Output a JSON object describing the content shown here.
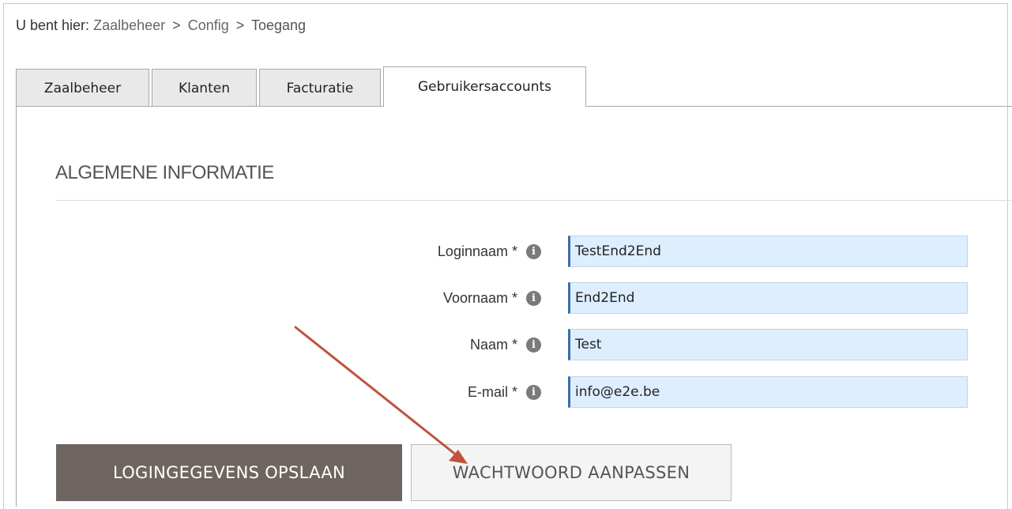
{
  "breadcrumb": {
    "prefix": "U bent hier:",
    "items": [
      "Zaalbeheer",
      "Config",
      "Toegang"
    ],
    "separator": ">"
  },
  "tabs": [
    {
      "label": "Zaalbeheer",
      "active": false
    },
    {
      "label": "Klanten",
      "active": false
    },
    {
      "label": "Facturatie",
      "active": false
    },
    {
      "label": "Gebruikersaccounts",
      "active": true
    }
  ],
  "section": {
    "title": "ALGEMENE INFORMATIE"
  },
  "form": {
    "fields": [
      {
        "label": "Loginnaam *",
        "value": "TestEnd2End",
        "info_icon": "info-icon"
      },
      {
        "label": "Voornaam *",
        "value": "End2End",
        "info_icon": "info-icon"
      },
      {
        "label": "Naam *",
        "value": "Test",
        "info_icon": "info-icon"
      },
      {
        "label": "E-mail *",
        "value": "info@e2e.be",
        "info_icon": "info-icon"
      }
    ],
    "info_glyph": "i"
  },
  "buttons": {
    "save_label": "LOGINGEGEVENS OPSLAAN",
    "password_label": "WACHTWOORD AANPASSEN"
  },
  "colors": {
    "save_button": "#6f6560",
    "input_background": "#ddeeff",
    "annotation_arrow": "#c0533f"
  }
}
